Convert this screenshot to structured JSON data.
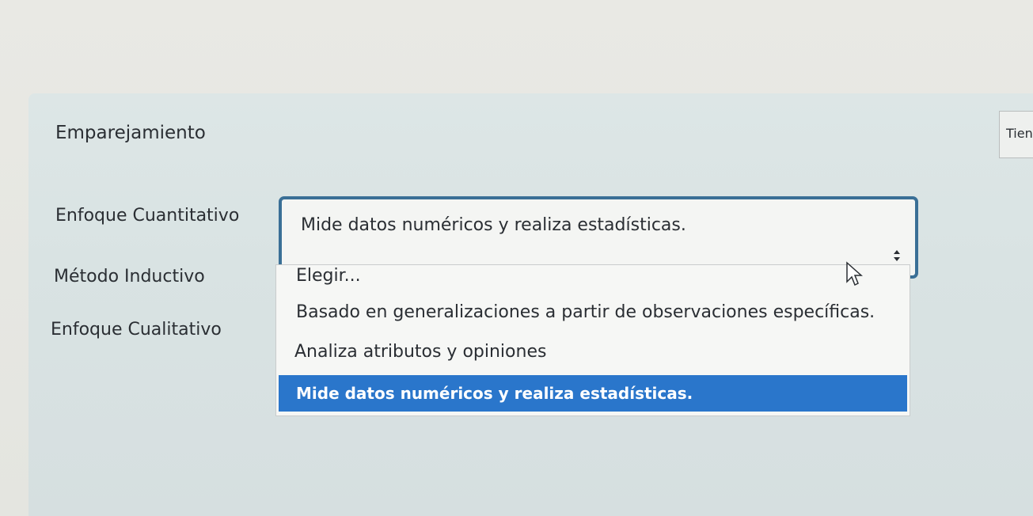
{
  "question": {
    "title": "Emparejamiento",
    "side_label": "Tien"
  },
  "rows": [
    {
      "label": "Enfoque Cuantitativo"
    },
    {
      "label": "Método Inductivo"
    },
    {
      "label": "Enfoque Cualitativo"
    }
  ],
  "select": {
    "current_value": "Mide datos numéricos y realiza estadísticas."
  },
  "dropdown": {
    "options": [
      "Elegir...",
      "Basado en generalizaciones a partir de observaciones específicas.",
      "Analiza atributos y opiniones",
      "Mide datos numéricos y realiza estadísticas."
    ],
    "selected_index": 3
  },
  "colors": {
    "select_border": "#3a6f96",
    "highlight": "#2a76cb"
  },
  "icons": {
    "arrow": "updown-arrow-icon",
    "cursor": "mouse-pointer-icon"
  }
}
